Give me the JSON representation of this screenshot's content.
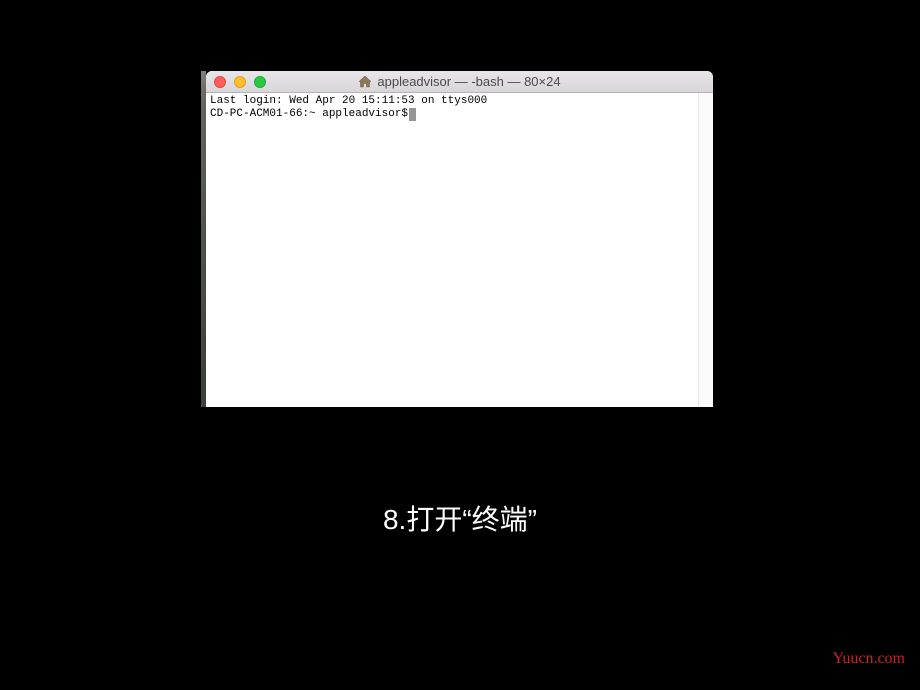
{
  "window": {
    "title": "appleadvisor — -bash — 80×24"
  },
  "terminal": {
    "line1": "Last login: Wed Apr 20 15:11:53 on ttys000",
    "prompt": "CD-PC-ACM01-66:~ appleadvisor$ "
  },
  "caption": "8.打开“终端”",
  "watermark": "Yuucn.com"
}
